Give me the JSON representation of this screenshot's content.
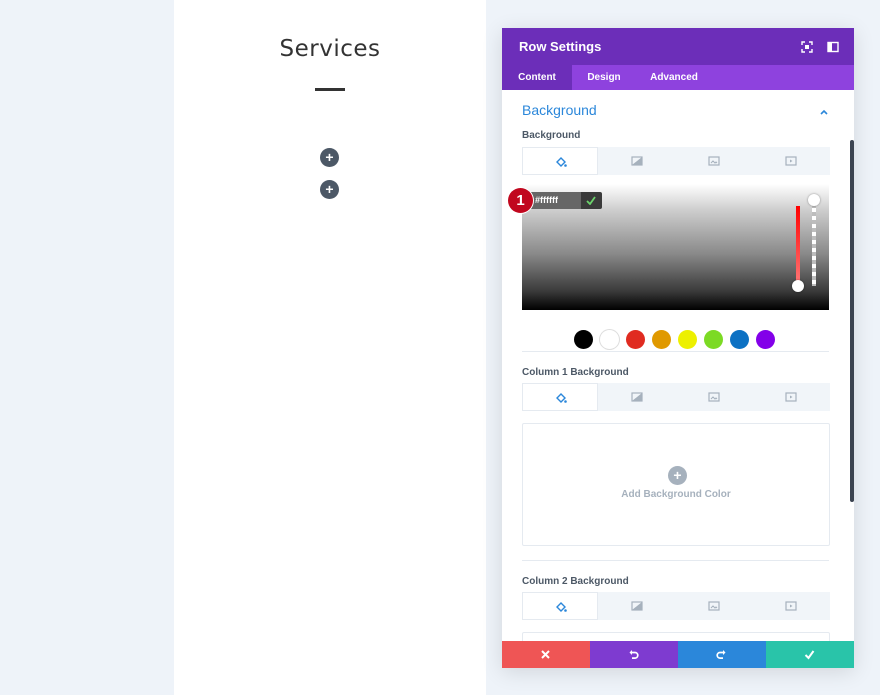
{
  "canvas": {
    "title": "Services",
    "add_buttons": [
      "+",
      "+"
    ]
  },
  "modal": {
    "title": "Row Settings",
    "header_icons": [
      "fullscreen-icon",
      "split-view-icon"
    ],
    "tabs": [
      {
        "label": "Content",
        "active": true
      },
      {
        "label": "Design",
        "active": false
      },
      {
        "label": "Advanced",
        "active": false
      }
    ],
    "section": {
      "title": "Background",
      "collapse_icon": "chevron-up-icon"
    },
    "background": {
      "label": "Background",
      "type_tabs": [
        "color-fill-icon",
        "gradient-icon",
        "image-icon",
        "video-icon"
      ],
      "hex_value": "#ffffff",
      "step_badge": "1",
      "swatches": [
        "#000000",
        "#ffffff",
        "#e02b20",
        "#e09900",
        "#edf000",
        "#7cda24",
        "#0c71c3",
        "#8300e9"
      ]
    },
    "column1": {
      "label": "Column 1 Background",
      "add_label": "Add Background Color"
    },
    "column2": {
      "label": "Column 2 Background"
    },
    "footer": {
      "buttons": [
        {
          "name": "cancel",
          "icon": "close-icon",
          "color": "#ef5555"
        },
        {
          "name": "undo",
          "icon": "undo-icon",
          "color": "#7e3bd0"
        },
        {
          "name": "redo",
          "icon": "redo-icon",
          "color": "#2b87da"
        },
        {
          "name": "save",
          "icon": "check-icon",
          "color": "#29c4a9"
        }
      ]
    }
  },
  "colors": {
    "header": "#6c2eb9",
    "tabs_bar": "#8e42de",
    "accent_blue": "#2b87da",
    "badge_red": "#c1071e"
  }
}
